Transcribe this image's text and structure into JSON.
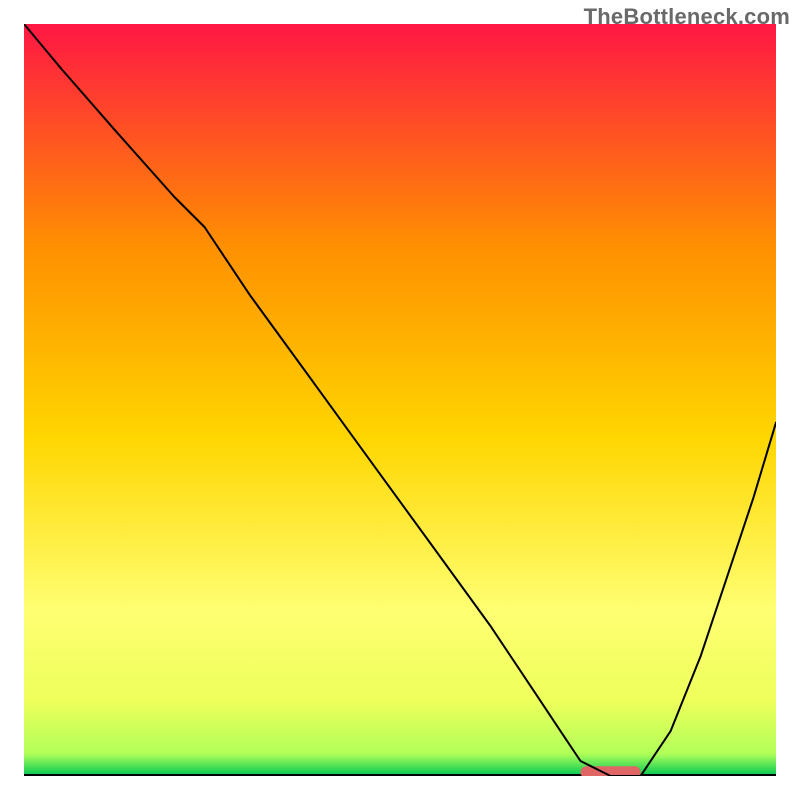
{
  "watermark": "TheBottleneck.com",
  "chart_data": {
    "type": "line",
    "title": "",
    "xlabel": "",
    "ylabel": "",
    "x_range": [
      0,
      100
    ],
    "y_range": [
      0,
      100
    ],
    "grid": false,
    "legend": false,
    "gradient_colors": {
      "top": "#ff1744",
      "mid_upper": "#ff9100",
      "mid": "#ffd600",
      "mid_lower": "#ffff72",
      "lower": "#eeff5b",
      "bottom": "#00c853"
    },
    "series": [
      {
        "name": "bottleneck-curve",
        "color": "#000000",
        "stroke_width": 2,
        "x": [
          0,
          5,
          12,
          20,
          24,
          30,
          38,
          46,
          54,
          62,
          68,
          72,
          74,
          78,
          82,
          86,
          90,
          94,
          97,
          100
        ],
        "y": [
          100,
          94,
          86,
          77,
          73,
          64,
          53,
          42,
          31,
          20,
          11,
          5,
          2,
          0,
          0,
          6,
          16,
          28,
          37,
          47
        ]
      }
    ],
    "marker": {
      "name": "optimal-marker",
      "color": "#e06666",
      "x_center": 78,
      "y": 0.5,
      "width": 8,
      "height": 1.6
    },
    "baseline": {
      "name": "x-axis-baseline",
      "color": "#000000",
      "y": 0
    }
  }
}
